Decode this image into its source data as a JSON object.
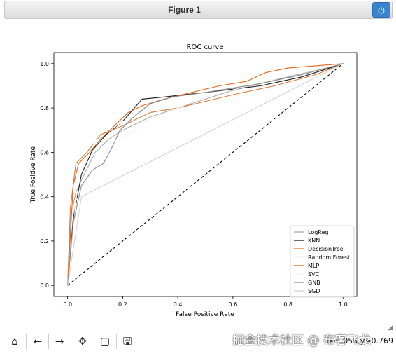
{
  "window": {
    "title": "Figure 1",
    "close_icon": "power-icon"
  },
  "chart_data": {
    "type": "line",
    "title": "ROC curve",
    "xlabel": "False Positive Rate",
    "ylabel": "True Positive Rate",
    "xlim": [
      -0.05,
      1.05
    ],
    "ylim": [
      -0.05,
      1.05
    ],
    "xticks": [
      0.0,
      0.2,
      0.4,
      0.6,
      0.8,
      1.0
    ],
    "yticks": [
      0.0,
      0.2,
      0.4,
      0.6,
      0.8,
      1.0
    ],
    "grid": false,
    "legend_position": "lower-right",
    "series": [
      {
        "name": "LogReg",
        "color": "#aaaaaa",
        "dash": "none",
        "points": [
          [
            0,
            0
          ],
          [
            0.01,
            0.3
          ],
          [
            0.03,
            0.42
          ],
          [
            0.06,
            0.5
          ],
          [
            0.1,
            0.6
          ],
          [
            0.15,
            0.66
          ],
          [
            0.2,
            0.7
          ],
          [
            0.3,
            0.76
          ],
          [
            0.4,
            0.8
          ],
          [
            0.5,
            0.84
          ],
          [
            0.6,
            0.88
          ],
          [
            0.7,
            0.91
          ],
          [
            0.8,
            0.94
          ],
          [
            0.9,
            0.97
          ],
          [
            1,
            1
          ]
        ]
      },
      {
        "name": "KNN",
        "color": "#1a1a1a",
        "dash": "none",
        "points": [
          [
            0,
            0
          ],
          [
            0.02,
            0.3
          ],
          [
            0.05,
            0.5
          ],
          [
            0.09,
            0.61
          ],
          [
            0.14,
            0.68
          ],
          [
            0.2,
            0.74
          ],
          [
            0.27,
            0.84
          ],
          [
            0.35,
            0.85
          ],
          [
            0.5,
            0.87
          ],
          [
            0.7,
            0.9
          ],
          [
            0.85,
            0.94
          ],
          [
            1,
            1
          ]
        ]
      },
      {
        "name": "DecisionTree",
        "color": "#d97a3a",
        "dash": "none",
        "points": [
          [
            0,
            0
          ],
          [
            0.01,
            0.35
          ],
          [
            0.03,
            0.55
          ],
          [
            0.07,
            0.6
          ],
          [
            0.12,
            0.68
          ],
          [
            0.2,
            0.72
          ],
          [
            0.3,
            0.78
          ],
          [
            0.4,
            0.8
          ],
          [
            0.5,
            0.83
          ],
          [
            0.6,
            0.86
          ],
          [
            0.75,
            0.9
          ],
          [
            0.9,
            0.95
          ],
          [
            1,
            1
          ]
        ]
      },
      {
        "name": "Random Forest",
        "color": "#ffffff",
        "dash": "none",
        "points": [
          [
            0,
            0
          ],
          [
            0.02,
            0.4
          ],
          [
            0.06,
            0.55
          ],
          [
            0.1,
            0.65
          ],
          [
            0.2,
            0.74
          ],
          [
            0.35,
            0.82
          ],
          [
            0.5,
            0.87
          ],
          [
            0.7,
            0.92
          ],
          [
            1,
            1
          ]
        ]
      },
      {
        "name": "MLP",
        "color": "#e8641c",
        "dash": "none",
        "points": [
          [
            0,
            0
          ],
          [
            0.02,
            0.45
          ],
          [
            0.04,
            0.55
          ],
          [
            0.08,
            0.6
          ],
          [
            0.12,
            0.66
          ],
          [
            0.17,
            0.72
          ],
          [
            0.22,
            0.78
          ],
          [
            0.27,
            0.81
          ],
          [
            0.35,
            0.84
          ],
          [
            0.45,
            0.87
          ],
          [
            0.55,
            0.9
          ],
          [
            0.65,
            0.92
          ],
          [
            0.72,
            0.96
          ],
          [
            0.8,
            0.98
          ],
          [
            1,
            1
          ]
        ]
      },
      {
        "name": "SVC",
        "color": "#f4f4f4",
        "dash": "none",
        "points": [
          [
            0,
            0
          ],
          [
            0.03,
            0.38
          ],
          [
            0.08,
            0.5
          ],
          [
            0.15,
            0.62
          ],
          [
            0.3,
            0.75
          ],
          [
            0.5,
            0.85
          ],
          [
            0.75,
            0.93
          ],
          [
            1,
            1
          ]
        ]
      },
      {
        "name": "GNB",
        "color": "#8a8a8a",
        "dash": "none",
        "points": [
          [
            0,
            0
          ],
          [
            0.02,
            0.28
          ],
          [
            0.05,
            0.45
          ],
          [
            0.09,
            0.52
          ],
          [
            0.13,
            0.55
          ],
          [
            0.16,
            0.62
          ],
          [
            0.19,
            0.7
          ],
          [
            0.24,
            0.76
          ],
          [
            0.3,
            0.82
          ],
          [
            0.38,
            0.85
          ],
          [
            0.5,
            0.87
          ],
          [
            0.7,
            0.91
          ],
          [
            0.85,
            0.95
          ],
          [
            1,
            1
          ]
        ]
      },
      {
        "name": "SGD",
        "color": "#d3d3d3",
        "dash": "none",
        "points": [
          [
            0,
            0
          ],
          [
            0.05,
            0.4
          ],
          [
            1,
            1
          ]
        ]
      },
      {
        "name": "",
        "color": "#000000",
        "dash": "4,3",
        "points": [
          [
            0,
            0
          ],
          [
            1,
            1
          ]
        ]
      }
    ]
  },
  "toolbar": {
    "items": [
      "home-icon",
      "back-icon",
      "forward-icon",
      "pan-icon",
      "zoom-icon",
      "save-icon"
    ],
    "coordinates": "x=0.055 y=0.769"
  },
  "watermark": "掘金技术社区 @ 布客飞龙"
}
